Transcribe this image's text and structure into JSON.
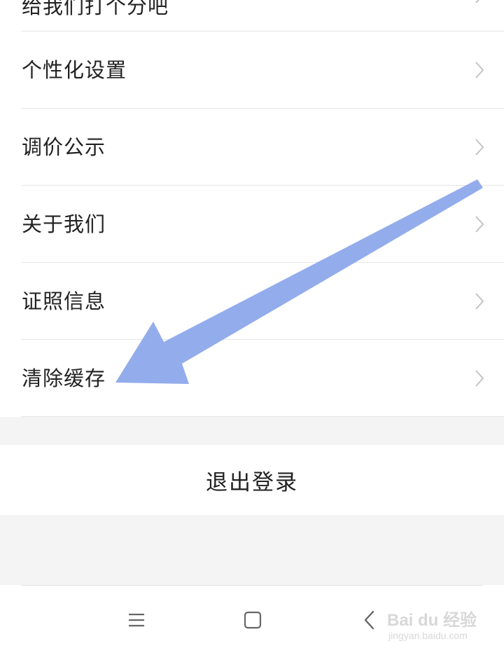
{
  "settings": {
    "items": [
      {
        "label": "给我们打个分吧"
      },
      {
        "label": "个性化设置"
      },
      {
        "label": "调价公示"
      },
      {
        "label": "关于我们"
      },
      {
        "label": "证照信息"
      },
      {
        "label": "清除缓存"
      }
    ]
  },
  "logout": {
    "label": "退出登录"
  },
  "navbar": {
    "menu_icon": "menu-icon",
    "home_icon": "home-square-icon",
    "back_icon": "back-chevron-icon"
  },
  "watermark": {
    "main": "Bai du 经验",
    "sub": "jingyan.baidu.com"
  },
  "colors": {
    "background": "#ffffff",
    "band": "#f4f4f4",
    "divider": "#e6e6e6",
    "text": "#222222",
    "chevron": "#c4c4c4",
    "annotation_arrow": "#93acec"
  }
}
